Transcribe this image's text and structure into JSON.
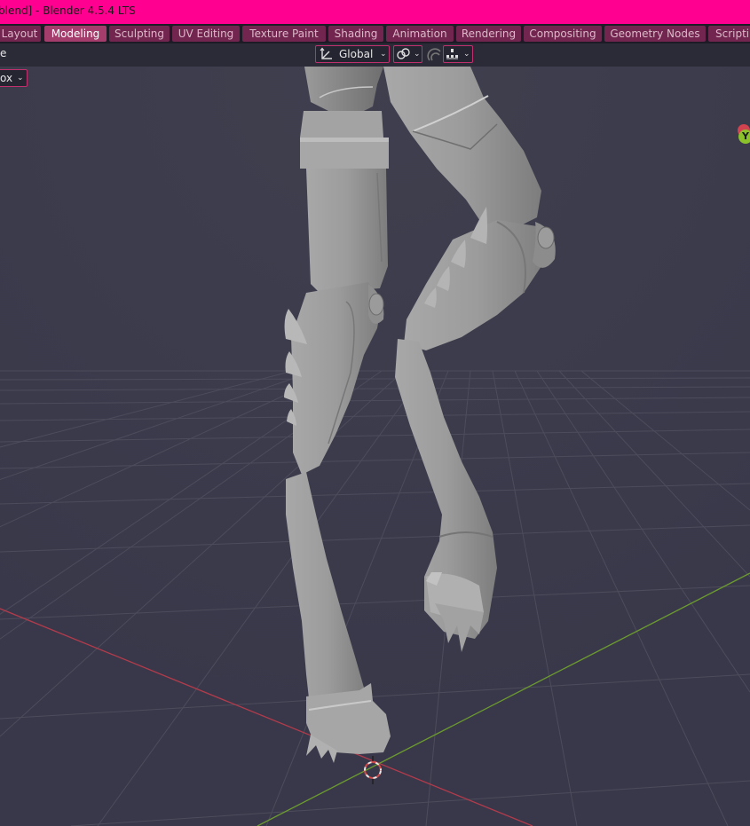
{
  "window": {
    "title": "blend] - Blender 4.5.4 LTS"
  },
  "workspace_tabs": [
    {
      "label": "Layout",
      "active": false
    },
    {
      "label": "Modeling",
      "active": true
    },
    {
      "label": "Sculpting",
      "active": false
    },
    {
      "label": "UV Editing",
      "active": false
    },
    {
      "label": "Texture Paint",
      "active": false
    },
    {
      "label": "Shading",
      "active": false
    },
    {
      "label": "Animation",
      "active": false
    },
    {
      "label": "Rendering",
      "active": false
    },
    {
      "label": "Compositing",
      "active": false
    },
    {
      "label": "Geometry Nodes",
      "active": false
    },
    {
      "label": "Scripting",
      "active": false
    }
  ],
  "header": {
    "left_fragment": "e",
    "transform_orientation": "Global",
    "transform_orientation_icon": "transform-orientation-icon",
    "pivot_icon": "pivot-point-icon",
    "snap_icon": "snap-magnet-icon",
    "proportional_icon": "proportional-editing-icon"
  },
  "toolbar": {
    "select_mode": "ox"
  },
  "gizmo": {
    "y_label": "Y"
  },
  "colors": {
    "title_bar": "#ff0090",
    "tab_active": "#a53d6c",
    "tab_inactive": "#72254f",
    "viewport_bg": "#393947",
    "x_axis": "#b33b4b",
    "y_axis": "#6c9b2e"
  }
}
